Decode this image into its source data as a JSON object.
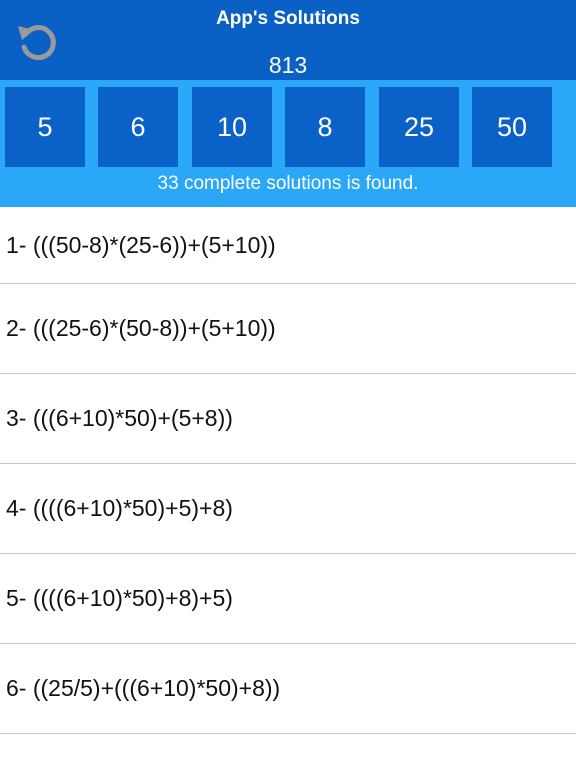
{
  "header": {
    "title": "App's Solutions",
    "target": "813",
    "reset_icon": "reset-arrow-icon"
  },
  "numbers": [
    "5",
    "6",
    "10",
    "8",
    "25",
    "50"
  ],
  "status": "33 complete solutions is found.",
  "solutions": [
    "1- (((50-8)*(25-6))+(5+10))",
    "2- (((25-6)*(50-8))+(5+10))",
    "3- (((6+10)*50)+(5+8))",
    "4- ((((6+10)*50)+5)+8)",
    "5- ((((6+10)*50)+8)+5)",
    "6- ((25/5)+(((6+10)*50)+8))"
  ],
  "colors": {
    "header_bg": "#0a60c5",
    "panel_bg": "#2aa8f7",
    "tile_bg": "#0a62c9",
    "icon_gray": "#9a9a9a"
  }
}
